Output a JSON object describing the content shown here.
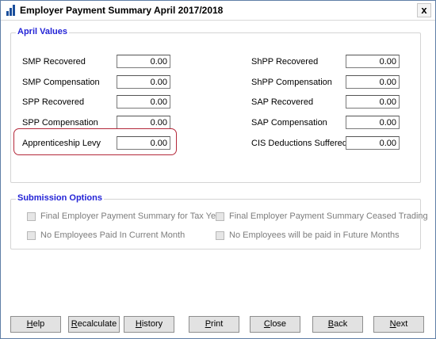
{
  "window": {
    "title": "Employer Payment Summary April 2017/2018",
    "close_glyph": "x"
  },
  "april_values": {
    "title": "April Values",
    "left": [
      {
        "label": "SMP Recovered",
        "value": "0.00"
      },
      {
        "label": "SMP Compensation",
        "value": "0.00"
      },
      {
        "label": "SPP Recovered",
        "value": "0.00"
      },
      {
        "label": "SPP Compensation",
        "value": "0.00"
      },
      {
        "label": "Apprenticeship Levy",
        "value": "0.00"
      }
    ],
    "right": [
      {
        "label": "ShPP Recovered",
        "value": "0.00"
      },
      {
        "label": "ShPP Compensation",
        "value": "0.00"
      },
      {
        "label": "SAP Recovered",
        "value": "0.00"
      },
      {
        "label": "SAP Compensation",
        "value": "0.00"
      },
      {
        "label": "CIS Deductions Suffered",
        "value": "0.00"
      }
    ],
    "highlight_color": "#b4283a"
  },
  "submission_options": {
    "title": "Submission Options",
    "options": [
      {
        "label": "Final Employer Payment Summary for Tax Year",
        "checked": false
      },
      {
        "label": "Final Employer Payment Summary Ceased Trading",
        "checked": false
      },
      {
        "label": "No Employees Paid In Current Month",
        "checked": false
      },
      {
        "label": "No Employees will be paid in Future Months",
        "checked": false
      }
    ]
  },
  "buttons": {
    "help": {
      "hot": "H",
      "rest": "elp"
    },
    "recalculate": {
      "hot": "R",
      "rest": "ecalculate"
    },
    "history": {
      "hot": "H",
      "rest": "istory"
    },
    "print": {
      "hot": "P",
      "rest": "rint"
    },
    "close": {
      "hot": "C",
      "rest": "lose"
    },
    "back": {
      "hot": "B",
      "rest": "ack"
    },
    "next": {
      "hot": "N",
      "rest": "ext"
    }
  },
  "colors": {
    "group_title": "#2323d6",
    "disabled_text": "#7d7d7d"
  }
}
